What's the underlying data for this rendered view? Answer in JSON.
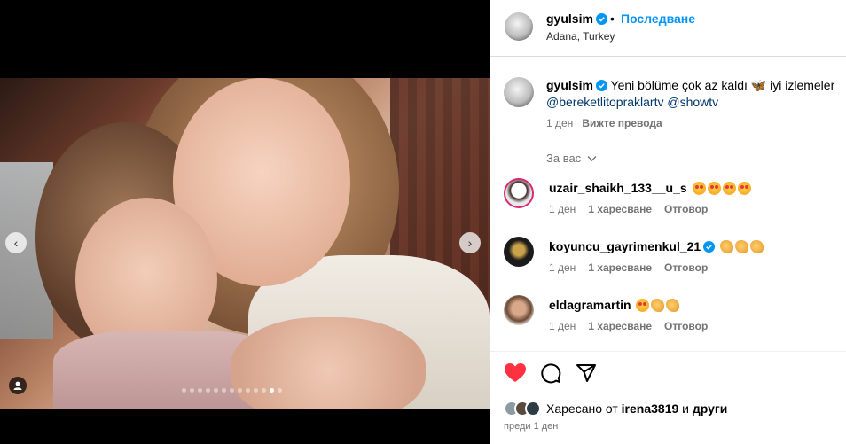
{
  "post": {
    "username": "gyulsim",
    "follow_label": "Последване",
    "separator": "•",
    "location": "Adana, Turkey"
  },
  "caption": {
    "username": "gyulsim",
    "text": "Yeni bölüme çok az kaldı 🦋 iyi izlemeler",
    "mentions": "@bereketlitopraklartv @showtv",
    "time": "1 ден",
    "translate_label": "Вижте превода"
  },
  "comments_filter": {
    "label": "За вас",
    "icon": "chevron-down-icon"
  },
  "comments": [
    {
      "username": "uzair_shaikh_133__u_s",
      "emojis": [
        "heart-eyes",
        "heart-eyes",
        "heart-eyes",
        "heart-eyes"
      ],
      "time": "1 ден",
      "likes": "1 харесване",
      "reply": "Отговор"
    },
    {
      "username": "koyuncu_gayrimenkul_21",
      "verified": true,
      "emojis": [
        "clap",
        "clap",
        "clap"
      ],
      "time": "1 ден",
      "likes": "1 харесване",
      "reply": "Отговор"
    },
    {
      "username": "eldagramartin",
      "emojis": [
        "heart-eyes",
        "clap",
        "clap"
      ],
      "time": "1 ден",
      "likes": "1 харесване",
      "reply": "Отговор"
    }
  ],
  "likes": {
    "prefix": "Харесано от",
    "user": "irena3819",
    "and": "и",
    "others": "други"
  },
  "date": "преди 1 ден",
  "carousel": {
    "count": 13,
    "active_index": 11
  },
  "colors": {
    "accent": "#0095f6",
    "like": "#ff3040",
    "verified": "#0095f6",
    "link": "#00376b"
  }
}
